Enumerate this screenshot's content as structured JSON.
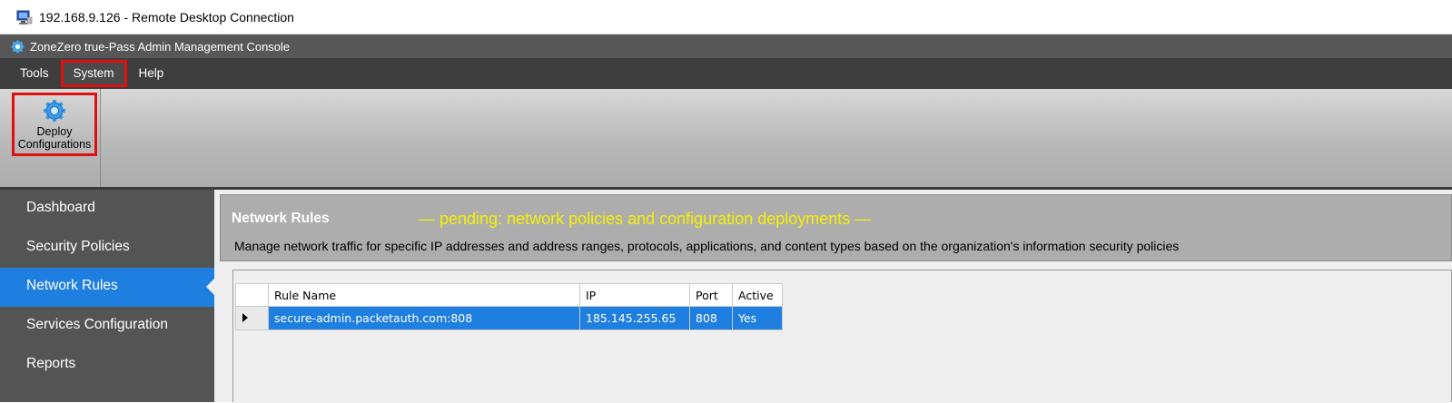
{
  "rdp": {
    "title": "192.168.9.126 - Remote Desktop Connection"
  },
  "app": {
    "title": "ZoneZero true-Pass Admin Management Console"
  },
  "menu": {
    "items": [
      {
        "label": "Tools"
      },
      {
        "label": "System",
        "highlighted": true
      },
      {
        "label": "Help"
      }
    ]
  },
  "ribbon": {
    "deploy_line1": "Deploy",
    "deploy_line2": "Configurations",
    "deploy_icon": "gear-icon"
  },
  "sidebar": {
    "items": [
      {
        "label": "Dashboard"
      },
      {
        "label": "Security Policies"
      },
      {
        "label": "Network Rules",
        "active": true
      },
      {
        "label": "Services Configuration"
      },
      {
        "label": "Reports"
      }
    ]
  },
  "header": {
    "title": "Network Rules",
    "pending": "— pending: network policies and configuration deployments —",
    "description": "Manage network traffic for specific IP addresses and address ranges, protocols, applications, and content types based on the organization's information security policies"
  },
  "grid": {
    "columns": [
      "Rule Name",
      "IP",
      "Port",
      "Active"
    ],
    "rows": [
      {
        "rule_name": "secure-admin.packetauth.com:808",
        "ip": "185.145.255.65",
        "port": "808",
        "active": "Yes"
      }
    ]
  },
  "colors": {
    "accent": "#1f7fe0",
    "highlight_border": "#e01010",
    "pending_text": "#f7f000",
    "sidebar_bg": "#545454"
  }
}
